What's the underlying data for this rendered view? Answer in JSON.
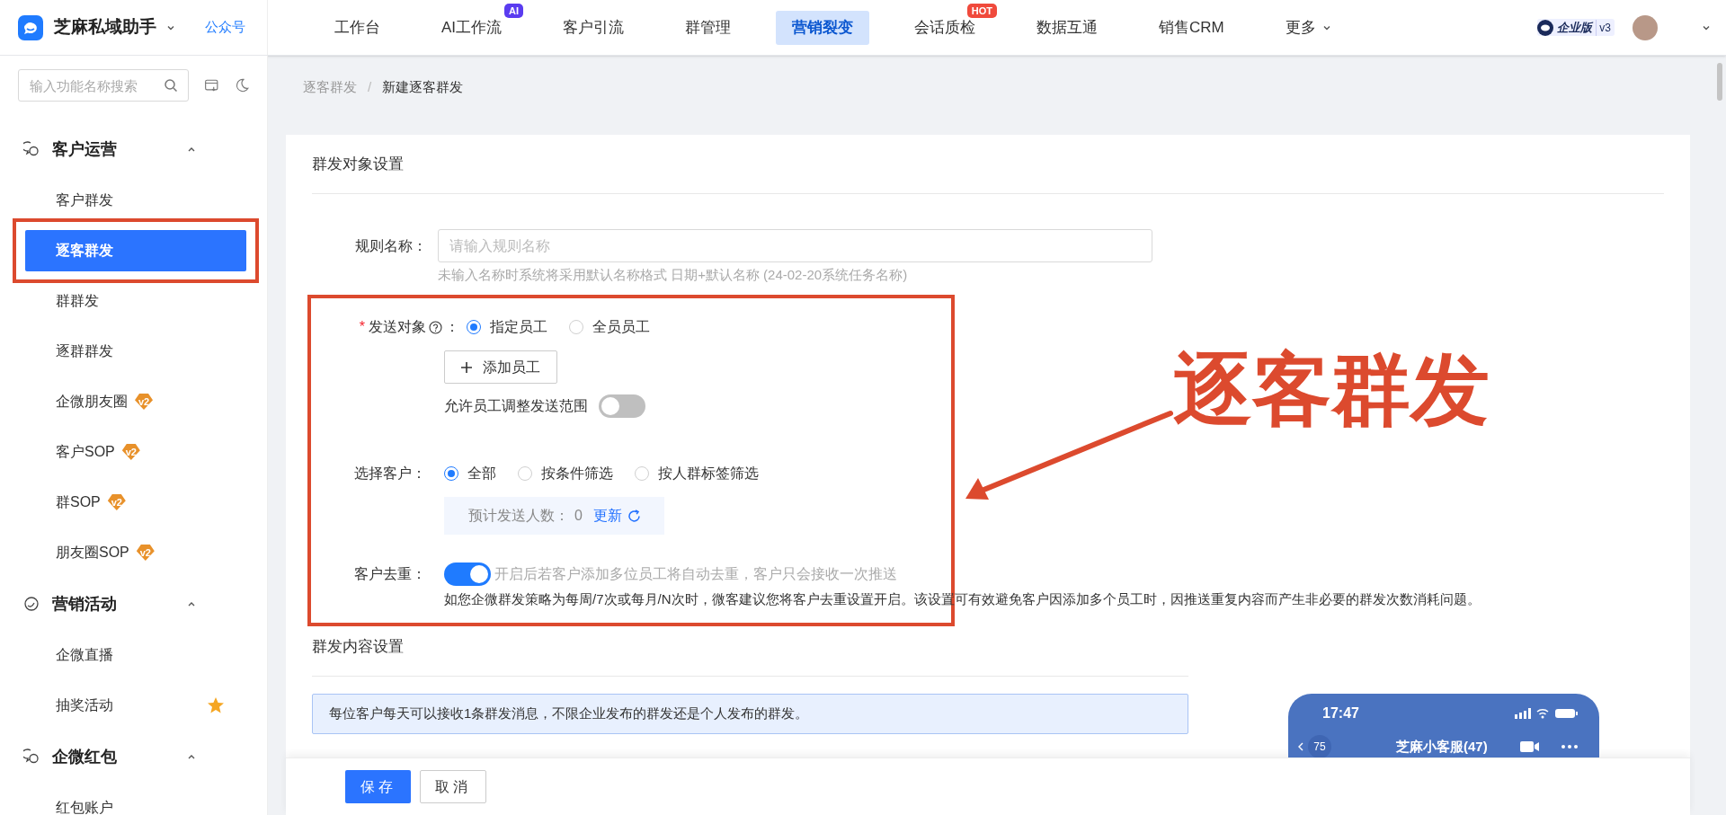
{
  "header": {
    "app_name": "芝麻私域助手",
    "account_link": "公众号",
    "nav": [
      {
        "label": "工作台",
        "selected": false
      },
      {
        "label": "AI工作流",
        "selected": false,
        "badge": {
          "text": "AI",
          "color": "#5a3cf0"
        }
      },
      {
        "label": "客户引流",
        "selected": false
      },
      {
        "label": "群管理",
        "selected": false
      },
      {
        "label": "营销裂变",
        "selected": true
      },
      {
        "label": "会话质检",
        "selected": false,
        "badge": {
          "text": "HOT",
          "color": "#f04a3c"
        }
      },
      {
        "label": "数据互通",
        "selected": false
      },
      {
        "label": "销售CRM",
        "selected": false
      },
      {
        "label": "更多",
        "selected": false,
        "dropdown": true
      }
    ],
    "edition": "企业版",
    "version": "v3"
  },
  "sidebar": {
    "search_placeholder": "输入功能名称搜索",
    "sections": [
      {
        "title": "客户运营",
        "kind": "chat",
        "expanded": true,
        "items": [
          {
            "label": "客户群发",
            "selected": false
          },
          {
            "label": "逐客群发",
            "selected": true,
            "annotated": true
          },
          {
            "label": "群群发",
            "selected": false
          },
          {
            "label": "逐群群发",
            "selected": false
          },
          {
            "label": "企微朋友圈",
            "selected": false,
            "badge": "v2"
          },
          {
            "label": "客户SOP",
            "selected": false,
            "badge": "v2"
          },
          {
            "label": "群SOP",
            "selected": false,
            "badge": "v2"
          },
          {
            "label": "朋友圈SOP",
            "selected": false,
            "badge": "v2"
          }
        ]
      },
      {
        "title": "营销活动",
        "kind": "circle",
        "expanded": true,
        "items": [
          {
            "label": "企微直播",
            "selected": false
          },
          {
            "label": "抽奖活动",
            "selected": false,
            "starred": true
          }
        ]
      },
      {
        "title": "企微红包",
        "kind": "chat",
        "expanded": true,
        "items": [
          {
            "label": "红包账户",
            "selected": false
          }
        ]
      }
    ]
  },
  "breadcrumb": [
    "逐客群发",
    "新建逐客群发"
  ],
  "breadcrumb_separator": "/",
  "target_section": {
    "title": "群发对象设置",
    "rule_name": {
      "label": "规则名称：",
      "placeholder": "请输入规则名称",
      "hint": "未输入名称时系统将采用默认名称格式 日期+默认名称 (24-02-20系统任务名称)"
    },
    "annotated": true,
    "send_target": {
      "label": "发送对象",
      "colon": "：",
      "required_mark": "*",
      "options": [
        {
          "label": "指定员工",
          "selected": true
        },
        {
          "label": "全员员工",
          "selected": false
        }
      ],
      "add_button": "添加员工",
      "adjust_toggle": {
        "label": "允许员工调整发送范围",
        "on": false
      }
    },
    "customers": {
      "label": "选择客户：",
      "options": [
        {
          "label": "全部",
          "selected": true
        },
        {
          "label": "按条件筛选",
          "selected": false
        },
        {
          "label": "按人群标签筛选",
          "selected": false
        }
      ],
      "estimate_label": "预计发送人数：",
      "estimate_value": "0",
      "refresh": "更新"
    },
    "dedupe": {
      "label": "客户去重：",
      "on": true,
      "description": "开启后若客户添加多位员工将自动去重，客户只会接收一次推送",
      "note": "如您企微群发策略为每周/7次或每月/N次时，微客建议您将客户去重设置开启。该设置可有效避免客户因添加多个员工时，因推送重复内容而产生非必要的群发次数消耗问题。"
    }
  },
  "annotation": {
    "label": "逐客群发"
  },
  "content_section": {
    "title": "群发内容设置",
    "notice": "每位客户每天可以接收1条群发消息，不限企业发布的群发还是个人发布的群发。"
  },
  "phone_preview": {
    "time": "17:47",
    "unread": "75",
    "chat_title": "芝麻小客服(47)"
  },
  "footer": {
    "buttons": [
      {
        "label": "保存",
        "kind": "primary"
      },
      {
        "label": "取消",
        "kind": "default"
      }
    ]
  }
}
